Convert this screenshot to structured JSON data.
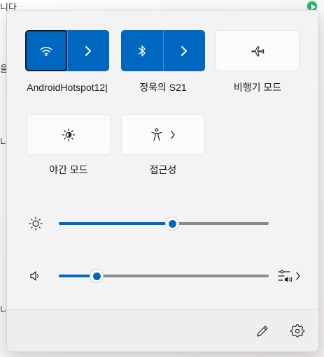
{
  "background": {
    "fragments": [
      "니다",
      "을",
      "니",
      "니"
    ]
  },
  "tiles": [
    {
      "id": "wifi",
      "label": "AndroidHotspot12​|",
      "state": "on",
      "main_icon": "wifi-icon",
      "has_arrow": true
    },
    {
      "id": "bluetooth",
      "label": "정욱의 S21",
      "state": "on",
      "main_icon": "bluetooth-icon",
      "has_arrow": true
    },
    {
      "id": "airplane",
      "label": "비행기 모드",
      "state": "off",
      "main_icon": "airplane-icon",
      "has_arrow": false
    },
    {
      "id": "night-light",
      "label": "야간 모드",
      "state": "off",
      "main_icon": "night-light-icon",
      "has_arrow": false
    },
    {
      "id": "accessibility",
      "label": "접근성",
      "state": "off",
      "main_icon": "accessibility-icon",
      "has_arrow": true
    }
  ],
  "sliders": {
    "brightness": {
      "icon": "sun-icon",
      "value": 0.54
    },
    "volume": {
      "icon": "speaker-icon",
      "value": 0.18,
      "extra_icon": "audio-output-icon"
    }
  },
  "footer": {
    "edit_icon": "pencil-icon",
    "settings_icon": "gear-icon"
  },
  "colors": {
    "accent": "#0067c0",
    "panel": "#f3f3f3",
    "tile_off": "#fbfbfb"
  }
}
